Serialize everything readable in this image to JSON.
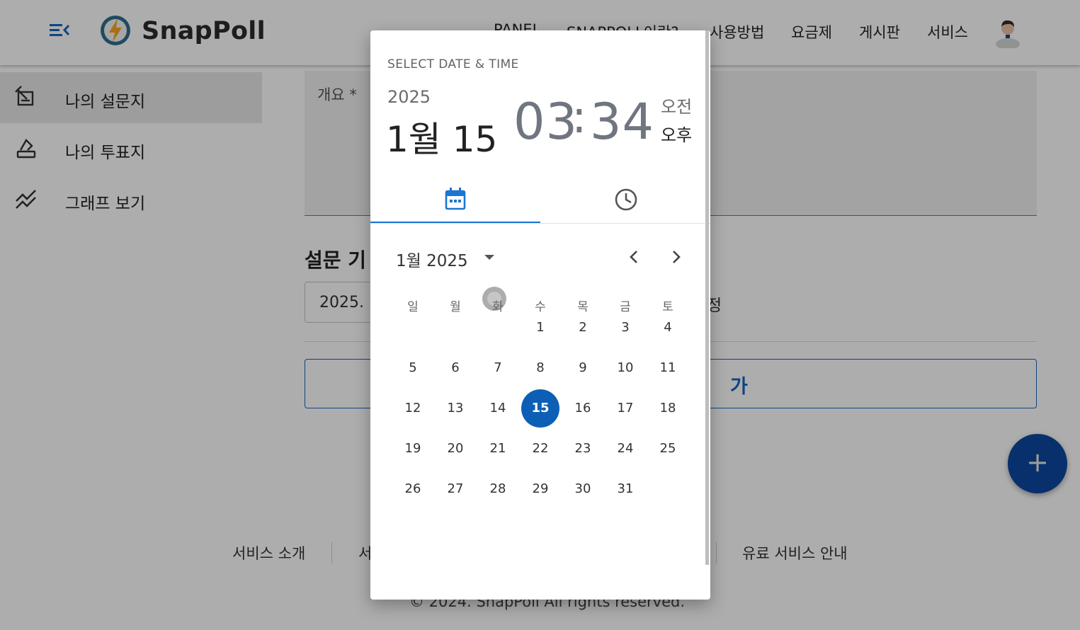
{
  "header": {
    "brand": "SnapPoll",
    "nav": [
      "PANEL",
      "SNAPPOLL이란?",
      "사용방법",
      "요금제",
      "게시판",
      "서비스"
    ]
  },
  "sidebar": {
    "items": [
      {
        "label": "나의 설문지",
        "icon": "survey-edit-icon",
        "active": true
      },
      {
        "label": "나의 투표지",
        "icon": "vote-box-icon",
        "active": false
      },
      {
        "label": "그래프 보기",
        "icon": "chart-line-icon",
        "active": false
      }
    ]
  },
  "main": {
    "textarea_label": "개요 *",
    "section_title": "설문 기",
    "date_input_value": "2025. (",
    "edit_text": "정",
    "add_button_label": "가",
    "fab_label": "+"
  },
  "footer": {
    "links": [
      "서비스 소개",
      "서",
      "유료 서비스 안내"
    ],
    "copyright": "© 2024. SnapPoll All rights reserved."
  },
  "dialog": {
    "toolbar_title": "SELECT DATE & TIME",
    "year": "2025",
    "date": "1월 15",
    "hour": "03",
    "colon": ":",
    "minute": "34",
    "am": "오전",
    "pm": "오후",
    "selected_meridiem": "오후",
    "active_tab": "date",
    "tabs": [
      {
        "name": "date",
        "icon": "calendar-icon"
      },
      {
        "name": "time",
        "icon": "clock-icon"
      }
    ],
    "month_label": "1월 2025",
    "weekdays": [
      "일",
      "월",
      "화",
      "수",
      "목",
      "금",
      "토"
    ],
    "weeks": [
      [
        "",
        "",
        "",
        "1",
        "2",
        "3",
        "4"
      ],
      [
        "5",
        "6",
        "7",
        "8",
        "9",
        "10",
        "11"
      ],
      [
        "12",
        "13",
        "14",
        "15",
        "16",
        "17",
        "18"
      ],
      [
        "19",
        "20",
        "21",
        "22",
        "23",
        "24",
        "25"
      ],
      [
        "26",
        "27",
        "28",
        "29",
        "30",
        "31",
        ""
      ]
    ],
    "selected_day": "15"
  },
  "colors": {
    "accent": "#1976d2",
    "selected_day": "#0d5fb6",
    "fab": "#0d47a1",
    "brand_blue": "#1565c0"
  }
}
